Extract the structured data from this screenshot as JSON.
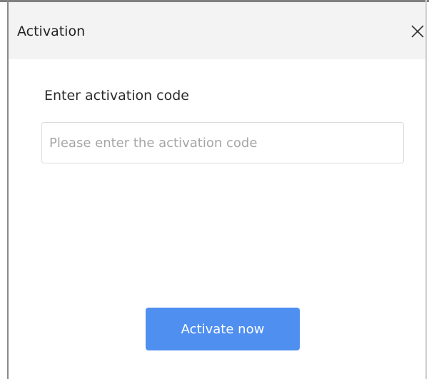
{
  "dialog": {
    "title": "Activation",
    "close_icon": "close-icon"
  },
  "form": {
    "label": "Enter activation code",
    "input_value": "",
    "input_placeholder": "Please enter the activation code"
  },
  "actions": {
    "activate_label": "Activate now"
  },
  "colors": {
    "accent": "#4f8ff0",
    "titlebar_bg": "#f3f3f3",
    "input_border": "#dcdcdc",
    "placeholder": "#a6a6a6"
  }
}
